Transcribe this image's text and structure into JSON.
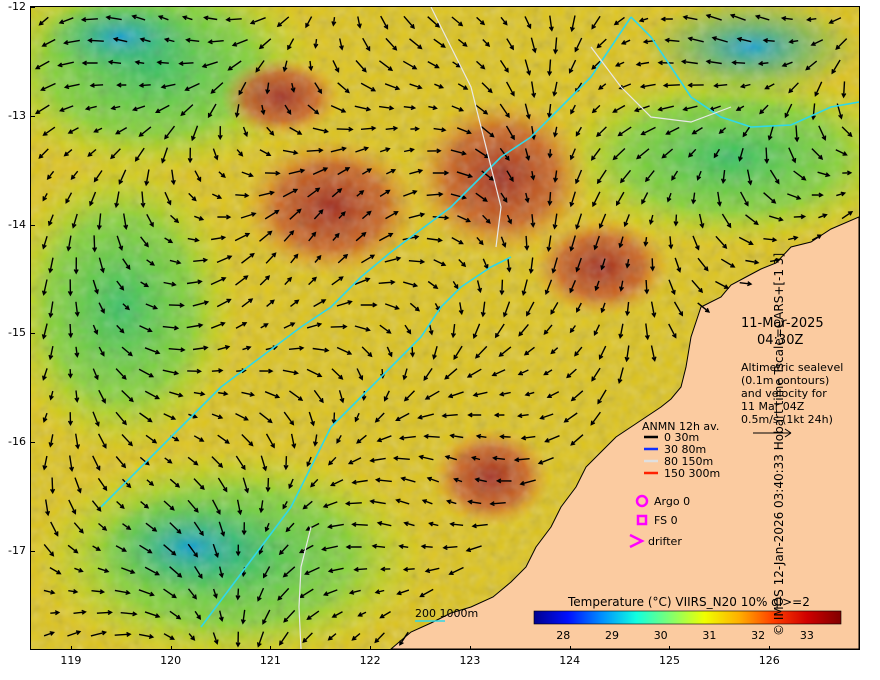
{
  "map": {
    "date": "11-Mar-2025",
    "time": "04:30Z",
    "description": [
      "Altimetric sealevel",
      "(0.1m contours)",
      "and velocity for",
      "11 Mar 04Z",
      "0.5m/s (1kt 24h)"
    ],
    "legend_title": "ANMN 12h av.",
    "legend_items": [
      {
        "label": "0 30m",
        "color": "#000000"
      },
      {
        "label": "30 80m",
        "color": "#1030ff"
      },
      {
        "label": "80 150m",
        "color": "#e0e0e0"
      },
      {
        "label": "150 300m",
        "color": "#ff2000"
      }
    ],
    "markers": [
      {
        "label": "Argo 0",
        "symbol": "circle",
        "color": "#ff00ff"
      },
      {
        "label": "FS 0",
        "symbol": "square",
        "color": "#ff00ff"
      },
      {
        "label": "drifter",
        "symbol": "chevron",
        "color": "#ff00ff"
      }
    ],
    "bathymetry_label": "200  1000m",
    "colorbar": {
      "title": "Temperature (°C) VIIRS_N20 10% ql>=2",
      "ticks": [
        "28",
        "29",
        "30",
        "31",
        "32",
        "33"
      ],
      "range": [
        27.4,
        33.7
      ],
      "colors": [
        "#00008f",
        "#0010ff",
        "#0090ff",
        "#10ffe0",
        "#80ff70",
        "#f0ff00",
        "#ffb000",
        "#ff4000",
        "#d00000",
        "#800000"
      ]
    },
    "x_axis": {
      "ticks": [
        "119",
        "120",
        "121",
        "122",
        "123",
        "124",
        "125",
        "126"
      ],
      "range": [
        118.6,
        126.9
      ]
    },
    "y_axis": {
      "ticks": [
        "-12",
        "-13",
        "-14",
        "-15",
        "-16",
        "-17"
      ],
      "range": [
        -12.0,
        -17.9
      ]
    },
    "credit": "© IMOS 12-Jan-2026 03:40:33 Hobart time Tscale=CARS+[-1 3]",
    "colors": {
      "land": "#fbcba0",
      "ocean_warm": "#f09a28",
      "ocean_hot": "#a0281a",
      "ocean_mid": "#c8f000",
      "ocean_cool": "#30c060",
      "contour_cyan": "#30d8e8"
    }
  }
}
